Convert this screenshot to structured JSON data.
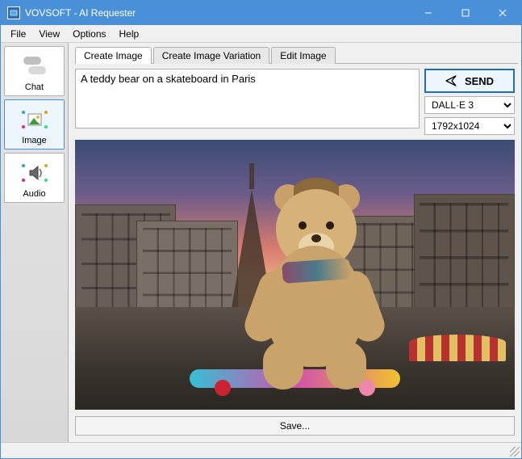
{
  "title": "VOVSOFT - AI Requester",
  "menu": {
    "file": "File",
    "view": "View",
    "options": "Options",
    "help": "Help"
  },
  "sidebar": {
    "chat": "Chat",
    "image": "Image",
    "audio": "Audio",
    "active": "image"
  },
  "tabs": {
    "create": "Create Image",
    "variation": "Create Image Variation",
    "edit": "Edit Image",
    "active": "create"
  },
  "prompt": "A teddy bear on a skateboard in Paris",
  "send_label": "SEND",
  "model_selected": "DALL·E 3",
  "size_selected": "1792x1024",
  "save_label": "Save..."
}
